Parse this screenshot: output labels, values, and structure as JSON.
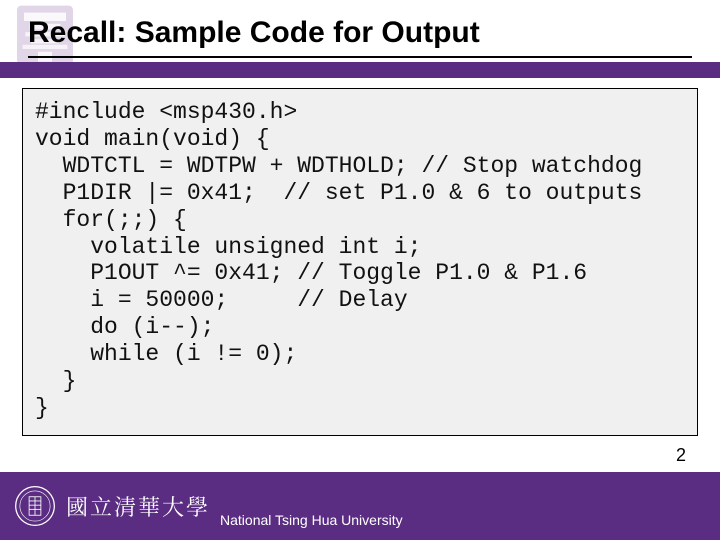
{
  "slide": {
    "title": "Recall: Sample Code for Output",
    "page_number": "2"
  },
  "code": {
    "lines": [
      "#include <msp430.h>",
      "void main(void) {",
      "  WDTCTL = WDTPW + WDTHOLD; // Stop watchdog",
      "  P1DIR |= 0x41;  // set P1.0 & 6 to outputs",
      "  for(;;) {",
      "    volatile unsigned int i;",
      "    P1OUT ^= 0x41; // Toggle P1.0 & P1.6",
      "    i = 50000;     // Delay",
      "    do (i--);",
      "    while (i != 0);",
      "  }",
      "}"
    ]
  },
  "footer": {
    "cn_name": "國立清華大學",
    "en_name": "National Tsing Hua University"
  }
}
